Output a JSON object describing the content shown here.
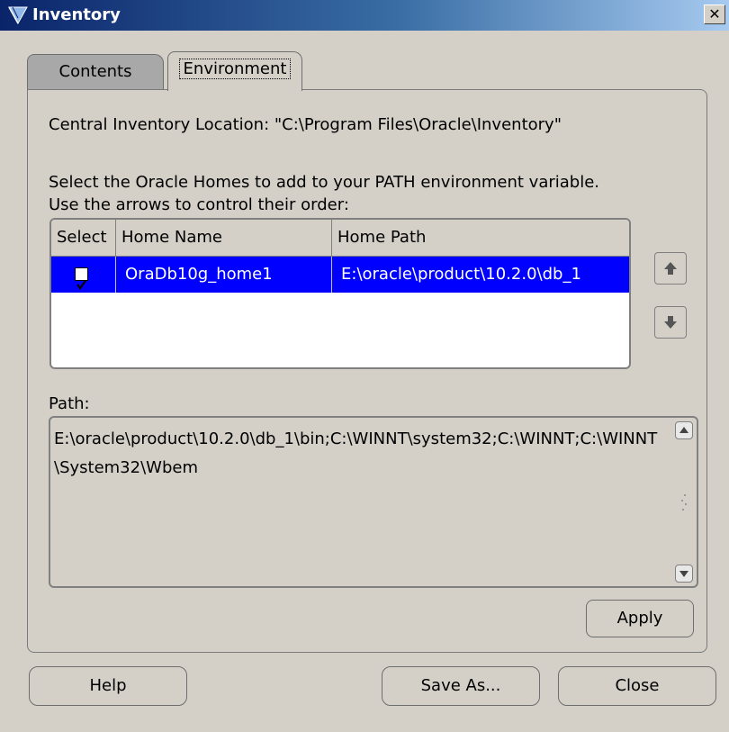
{
  "window": {
    "title": "Inventory",
    "close_glyph": "✕"
  },
  "tabs": [
    {
      "label": "Contents",
      "active": false
    },
    {
      "label": "Environment",
      "active": true
    }
  ],
  "environment": {
    "central_inventory": "Central Inventory Location: \"C:\\Program Files\\Oracle\\Inventory\"",
    "instructions_line1": "Select the Oracle Homes to add to your PATH environment variable.",
    "instructions_line2": "Use the arrows to control their order:",
    "table": {
      "headers": [
        "Select",
        "Home Name",
        "Home Path"
      ],
      "rows": [
        {
          "selected": true,
          "home_name": "OraDb10g_home1",
          "home_path": "E:\\oracle\\product\\10.2.0\\db_1"
        }
      ]
    },
    "path_label": "Path:",
    "path_value": "E:\\oracle\\product\\10.2.0\\db_1\\bin;C:\\WINNT\\system32;C:\\WINNT;C:\\WINNT\\System32\\Wbem"
  },
  "buttons": {
    "apply": "Apply",
    "help": "Help",
    "save_as": "Save As...",
    "close": "Close"
  },
  "icons": {
    "app": "oracle-inventory-icon",
    "move_up": "arrow-up-icon",
    "move_down": "arrow-down-icon"
  },
  "colors": {
    "selection": "#0000ff",
    "titlebar_start": "#0a246a",
    "titlebar_end": "#a6caf0",
    "dialog_bg": "#d4d0c8"
  }
}
